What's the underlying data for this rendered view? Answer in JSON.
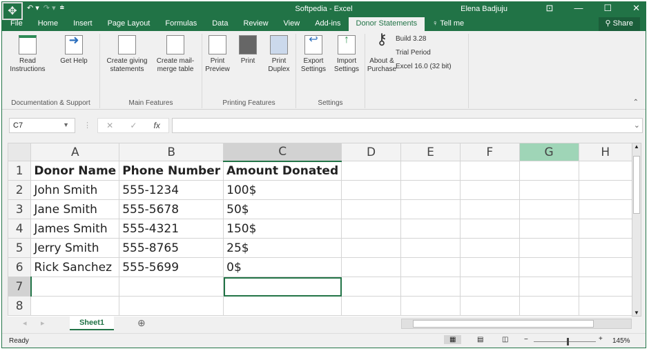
{
  "window": {
    "title": "Softpedia - Excel",
    "user": "Elena Badjuju"
  },
  "tabs": [
    "File",
    "Home",
    "Insert",
    "Page Layout",
    "Formulas",
    "Data",
    "Review",
    "View",
    "Add-ins",
    "Donor Statements",
    "Tell me"
  ],
  "active_tab": "Donor Statements",
  "share_label": "Share",
  "ribbon": {
    "groups": [
      {
        "label": "Documentation & Support",
        "buttons": [
          {
            "label": "Read Instructions"
          },
          {
            "label": "Get Help"
          }
        ]
      },
      {
        "label": "Main Features",
        "buttons": [
          {
            "label": "Create giving statements"
          },
          {
            "label": "Create mail-merge table"
          }
        ]
      },
      {
        "label": "Printing Features",
        "buttons": [
          {
            "label": "Print Preview"
          },
          {
            "label": "Print"
          },
          {
            "label": "Print Duplex"
          }
        ]
      },
      {
        "label": "Settings",
        "buttons": [
          {
            "label": "Export Settings"
          },
          {
            "label": "Import Settings"
          }
        ]
      },
      {
        "label": "",
        "buttons": [
          {
            "label": "About & Purchase"
          }
        ]
      }
    ],
    "info": [
      "Build 3.28",
      "Trial Period",
      "Excel 16.0 (32 bit)"
    ]
  },
  "name_box": "C7",
  "formula_value": "",
  "columns": [
    "A",
    "B",
    "C",
    "D",
    "E",
    "F",
    "G",
    "H"
  ],
  "rows": [
    [
      "Donor Name",
      "Phone Number",
      "Amount Donated",
      "",
      "",
      "",
      "",
      ""
    ],
    [
      "John Smith",
      "555-1234",
      "100$",
      "",
      "",
      "",
      "",
      ""
    ],
    [
      "Jane Smith",
      "555-5678",
      "50$",
      "",
      "",
      "",
      "",
      ""
    ],
    [
      "James Smith",
      "555-4321",
      "150$",
      "",
      "",
      "",
      "",
      ""
    ],
    [
      "Jerry Smith",
      "555-8765",
      "25$",
      "",
      "",
      "",
      "",
      ""
    ],
    [
      "Rick Sanchez",
      "555-5699",
      "0$",
      "",
      "",
      "",
      "",
      ""
    ],
    [
      "",
      "",
      "",
      "",
      "",
      "",
      "",
      ""
    ],
    [
      "",
      "",
      "",
      "",
      "",
      "",
      "",
      ""
    ]
  ],
  "sheet_tab": "Sheet1",
  "status": {
    "text": "Ready",
    "zoom": "145%"
  }
}
